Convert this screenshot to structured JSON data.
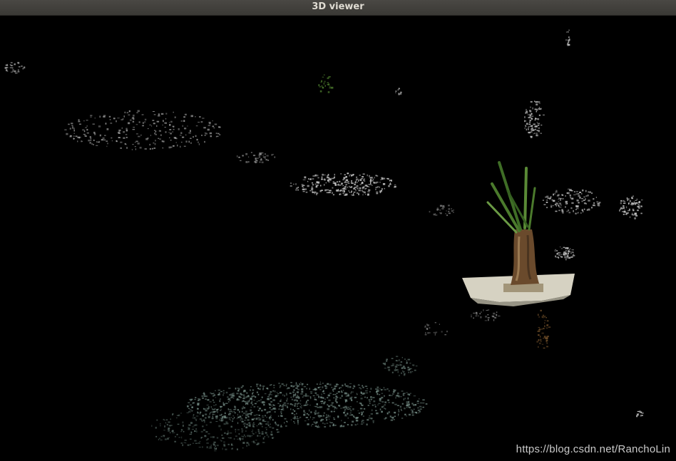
{
  "window": {
    "title": "3D viewer"
  },
  "viewer": {
    "content": "point-cloud",
    "background_color": "#000000",
    "scene_colors": {
      "gray_points": "#b8b8b8",
      "wall_points": "#cfcfcf",
      "floor_points": "#7f9a92",
      "planter": "#e8e4d2",
      "trunk": "#6a4a2c",
      "leaves": "#4b7a2c"
    }
  },
  "watermark": {
    "text": "https://blog.csdn.net/RanchoLin"
  }
}
